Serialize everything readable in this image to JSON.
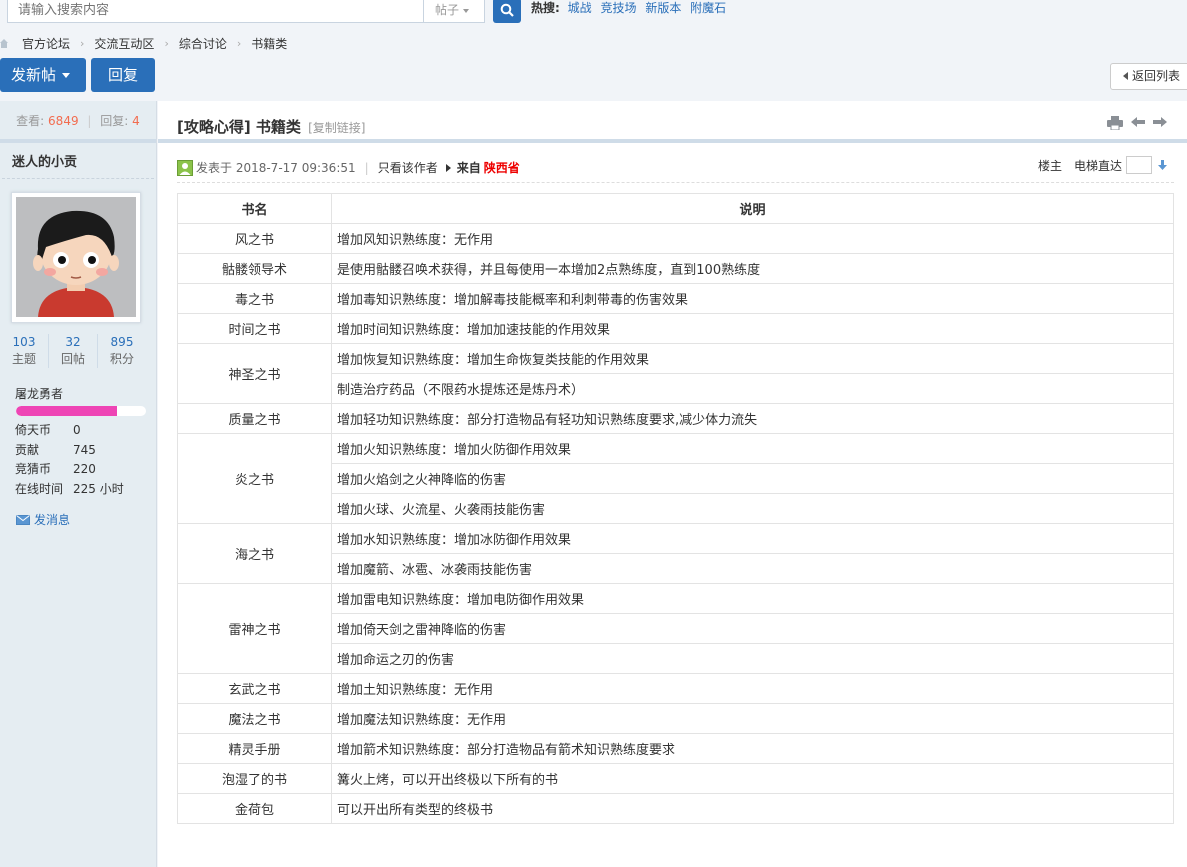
{
  "search": {
    "placeholder": "请输入搜索内容",
    "type": "帖子",
    "hot_label": "热搜:",
    "hot": [
      "城战",
      "竞技场",
      "新版本",
      "附魔石"
    ]
  },
  "breadcrumb": [
    "官方论坛",
    "交流互动区",
    "综合讨论",
    "书籍类"
  ],
  "actions": {
    "post": "发新帖",
    "reply": "回复",
    "back": "返回列表"
  },
  "sidebar": {
    "views_label": "查看:",
    "views": "6849",
    "replies_label": "回复:",
    "replies": "4",
    "author": "迷人的小贡",
    "stats": [
      {
        "value": "103",
        "label": "主题"
      },
      {
        "value": "32",
        "label": "回帖"
      },
      {
        "value": "895",
        "label": "积分"
      }
    ],
    "rank": "屠龙勇者",
    "rank_progress": 0.78,
    "info": [
      {
        "k": "倚天币",
        "v": "0"
      },
      {
        "k": "贡献",
        "v": "745"
      },
      {
        "k": "竞猜币",
        "v": "220"
      },
      {
        "k": "在线时间",
        "v": "225 小时"
      }
    ],
    "send_message": "发消息"
  },
  "post": {
    "title": "[攻略心得] 书籍类",
    "copy_link": "[复制链接]",
    "posted": "发表于 2018-7-17 09:36:51",
    "only_author": "只看该作者",
    "from_label": "来自",
    "province": "陕西省",
    "floor": "楼主",
    "jump_label": "电梯直达"
  },
  "table": {
    "headers": [
      "书名",
      "说明"
    ],
    "rows": [
      {
        "name": "风之书",
        "desc": [
          "增加风知识熟练度：无作用"
        ]
      },
      {
        "name": "骷髅领导术",
        "desc": [
          "是使用骷髅召唤术获得，并且每使用一本增加2点熟练度，直到100熟练度"
        ]
      },
      {
        "name": "毒之书",
        "desc": [
          "增加毒知识熟练度：增加解毒技能概率和利刺带毒的伤害效果"
        ]
      },
      {
        "name": "时间之书",
        "desc": [
          "增加时间知识熟练度：增加加速技能的作用效果"
        ]
      },
      {
        "name": "神圣之书",
        "desc": [
          "增加恢复知识熟练度：增加生命恢复类技能的作用效果",
          "制造治疗药品（不限药水提炼还是炼丹术）"
        ]
      },
      {
        "name": "质量之书",
        "desc": [
          "增加轻功知识熟练度：部分打造物品有轻功知识熟练度要求,减少体力流失"
        ]
      },
      {
        "name": "炎之书",
        "desc": [
          "增加火知识熟练度：增加火防御作用效果",
          "增加火焰剑之火神降临的伤害",
          "增加火球、火流星、火袭雨技能伤害"
        ]
      },
      {
        "name": "海之书",
        "desc": [
          "增加水知识熟练度：增加冰防御作用效果",
          "增加魔箭、冰雹、冰袭雨技能伤害"
        ]
      },
      {
        "name": "雷神之书",
        "desc": [
          "增加雷电知识熟练度：增加电防御作用效果",
          "增加倚天剑之雷神降临的伤害",
          "增加命运之刃的伤害"
        ]
      },
      {
        "name": "玄武之书",
        "desc": [
          "增加土知识熟练度：无作用"
        ]
      },
      {
        "name": "魔法之书",
        "desc": [
          "增加魔法知识熟练度：无作用"
        ]
      },
      {
        "name": "精灵手册",
        "desc": [
          "增加箭术知识熟练度：部分打造物品有箭术知识熟练度要求"
        ]
      },
      {
        "name": "泡湿了的书",
        "desc": [
          "篝火上烤，可以开出终极以下所有的书"
        ]
      },
      {
        "name": "金荷包",
        "desc": [
          "可以开出所有类型的终极书"
        ]
      }
    ]
  }
}
